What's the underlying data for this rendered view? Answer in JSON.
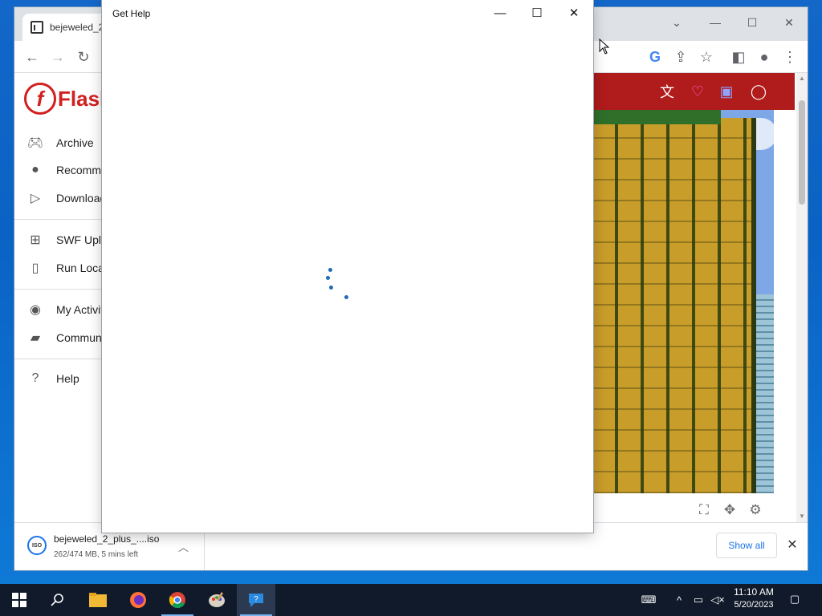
{
  "browser": {
    "tab_title": "bejeweled_2",
    "sidebar": {
      "logo_text": "Flash",
      "items": [
        {
          "label": "Archive",
          "icon": "gamepad-icon"
        },
        {
          "label": "Recomme",
          "icon": "thumbs-up-icon"
        },
        {
          "label": "Download",
          "icon": "play-icon"
        },
        {
          "label": "SWF Uplo",
          "icon": "plus-icon"
        },
        {
          "label": "Run Loca",
          "icon": "file-icon"
        },
        {
          "label": "My Activit",
          "icon": "account-icon"
        },
        {
          "label": "Communi",
          "icon": "forum-icon"
        },
        {
          "label": "Help",
          "icon": "help-icon"
        }
      ]
    },
    "header_icons": [
      "translate-icon",
      "heart-icon",
      "chat-icon",
      "user-icon"
    ],
    "game_controls": [
      "fullscreen-icon",
      "move-icon",
      "settings-icon"
    ]
  },
  "download_shelf": {
    "file_name": "bejeweled_2_plus_....iso",
    "status": "262/474 MB, 5 mins left",
    "icon_label": "ISO",
    "show_all": "Show all"
  },
  "dialog": {
    "title": "Get Help",
    "state": "loading"
  },
  "taskbar": {
    "apps": [
      "start-icon",
      "search-icon",
      "file-explorer-icon",
      "firefox-icon",
      "chrome-icon",
      "paint-icon",
      "get-help-icon"
    ],
    "time": "11:10 AM",
    "date": "5/20/2023"
  },
  "colors": {
    "accent": "#1a73e8",
    "site_header": "#b01b1b",
    "brand": "#d21f1f",
    "spinner": "#1e6bb8",
    "taskbar": "#101a2a"
  }
}
